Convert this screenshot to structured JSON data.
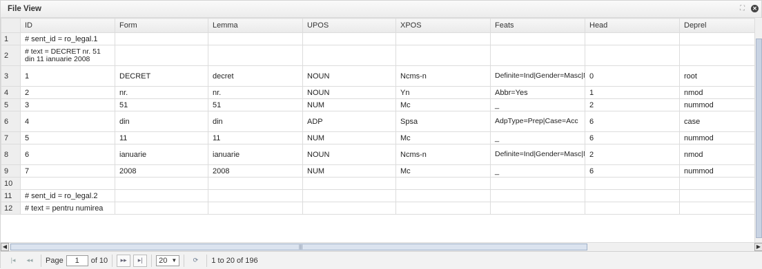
{
  "panel": {
    "title": "File View"
  },
  "columns": [
    "ID",
    "Form",
    "Lemma",
    "UPOS",
    "XPOS",
    "Feats",
    "Head",
    "Deprel"
  ],
  "rows": [
    {
      "n": "1",
      "id": "# sent_id = ro_legal.1",
      "form": "",
      "lemma": "",
      "upos": "",
      "xpos": "",
      "feats": "",
      "head": "",
      "deprel": ""
    },
    {
      "n": "2",
      "id": "# text = DECRET nr. 51 din 11 ianuarie 2008",
      "form": "",
      "lemma": "",
      "upos": "",
      "xpos": "",
      "feats": "",
      "head": "",
      "deprel": ""
    },
    {
      "n": "3",
      "id": "1",
      "form": "DECRET",
      "lemma": "decret",
      "upos": "NOUN",
      "xpos": "Ncms-n",
      "feats": "Definite=Ind|Gender=Masc|Number=Sing",
      "head": "0",
      "deprel": "root"
    },
    {
      "n": "4",
      "id": "2",
      "form": "nr.",
      "lemma": "nr.",
      "upos": "NOUN",
      "xpos": "Yn",
      "feats": "Abbr=Yes",
      "head": "1",
      "deprel": "nmod"
    },
    {
      "n": "5",
      "id": "3",
      "form": "51",
      "lemma": "51",
      "upos": "NUM",
      "xpos": "Mc",
      "feats": "_",
      "head": "2",
      "deprel": "nummod"
    },
    {
      "n": "6",
      "id": "4",
      "form": "din",
      "lemma": "din",
      "upos": "ADP",
      "xpos": "Spsa",
      "feats": "AdpType=Prep|Case=Acc",
      "head": "6",
      "deprel": "case"
    },
    {
      "n": "7",
      "id": "5",
      "form": "11",
      "lemma": "11",
      "upos": "NUM",
      "xpos": "Mc",
      "feats": "_",
      "head": "6",
      "deprel": "nummod"
    },
    {
      "n": "8",
      "id": "6",
      "form": "ianuarie",
      "lemma": "ianuarie",
      "upos": "NOUN",
      "xpos": "Ncms-n",
      "feats": "Definite=Ind|Gender=Masc|Number=Sing",
      "head": "2",
      "deprel": "nmod"
    },
    {
      "n": "9",
      "id": "7",
      "form": "2008",
      "lemma": "2008",
      "upos": "NUM",
      "xpos": "Mc",
      "feats": "_",
      "head": "6",
      "deprel": "nummod"
    },
    {
      "n": "10",
      "id": "",
      "form": "",
      "lemma": "",
      "upos": "",
      "xpos": "",
      "feats": "",
      "head": "",
      "deprel": ""
    },
    {
      "n": "11",
      "id": "# sent_id = ro_legal.2",
      "form": "",
      "lemma": "",
      "upos": "",
      "xpos": "",
      "feats": "",
      "head": "",
      "deprel": ""
    },
    {
      "n": "12",
      "id": "# text = pentru numirea",
      "form": "",
      "lemma": "",
      "upos": "",
      "xpos": "",
      "feats": "",
      "head": "",
      "deprel": ""
    }
  ],
  "pager": {
    "page_label": "Page",
    "page_value": "1",
    "of_label": "of 10",
    "page_size": "20",
    "range_text": "1 to 20 of 196"
  },
  "icons": {
    "first": "first-page-icon",
    "prev": "prev-page-icon",
    "next": "next-page-icon",
    "last": "last-page-icon",
    "refresh": "refresh-icon",
    "expand": "expand-icon",
    "close": "close-icon"
  }
}
